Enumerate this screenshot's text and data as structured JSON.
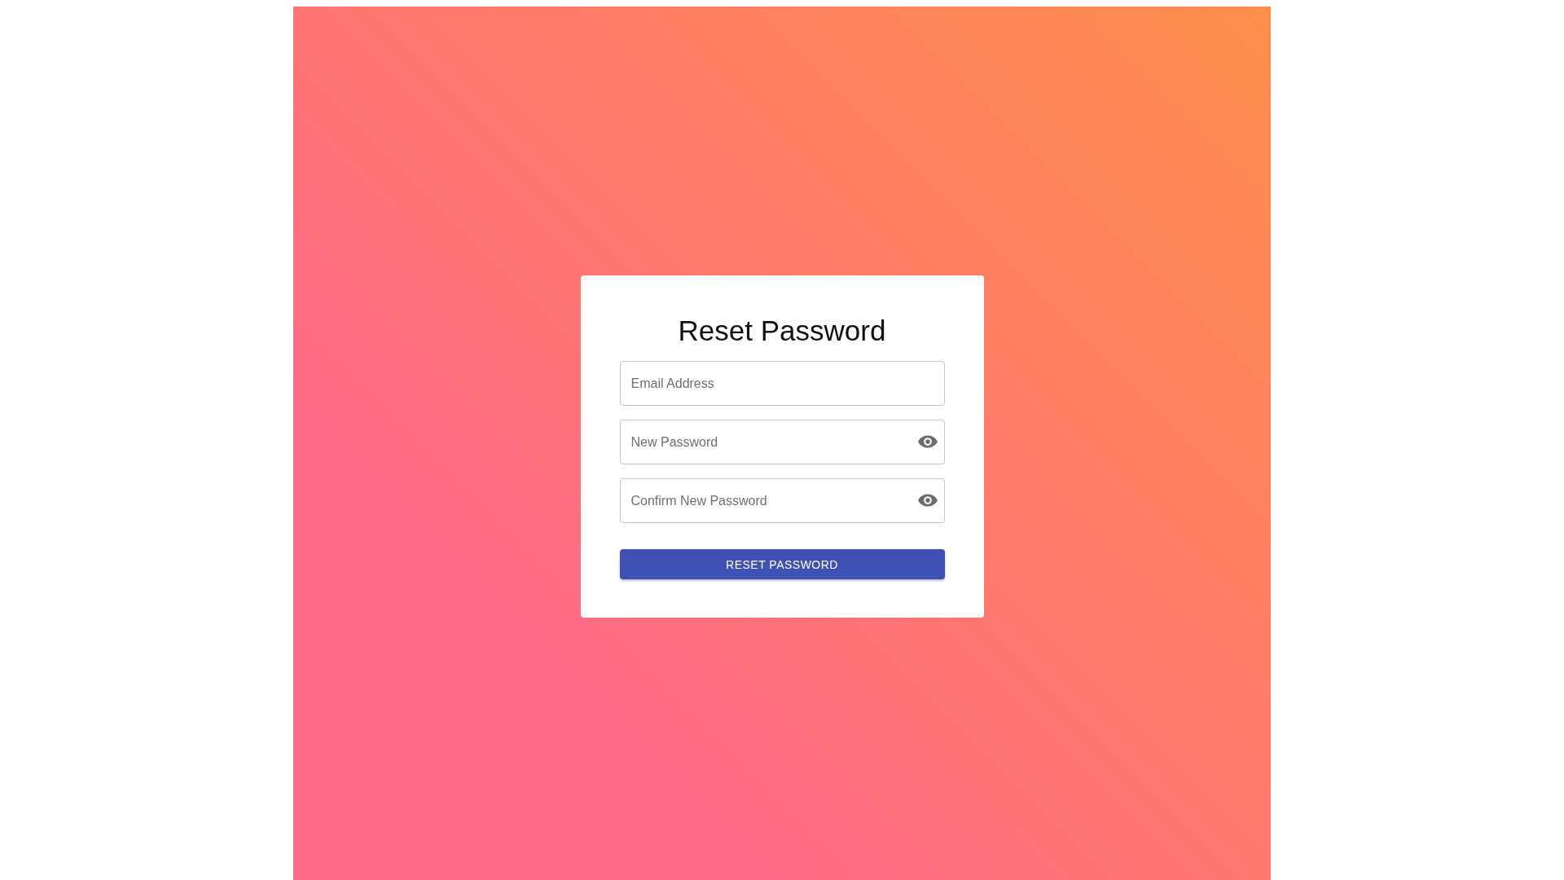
{
  "title": "Reset Password",
  "fields": [
    {
      "placeholder": "Email Address",
      "kind": "email"
    },
    {
      "placeholder": "New Password",
      "kind": "password"
    },
    {
      "placeholder": "Confirm New Password",
      "kind": "password"
    }
  ],
  "button": "RESET PASSWORD"
}
